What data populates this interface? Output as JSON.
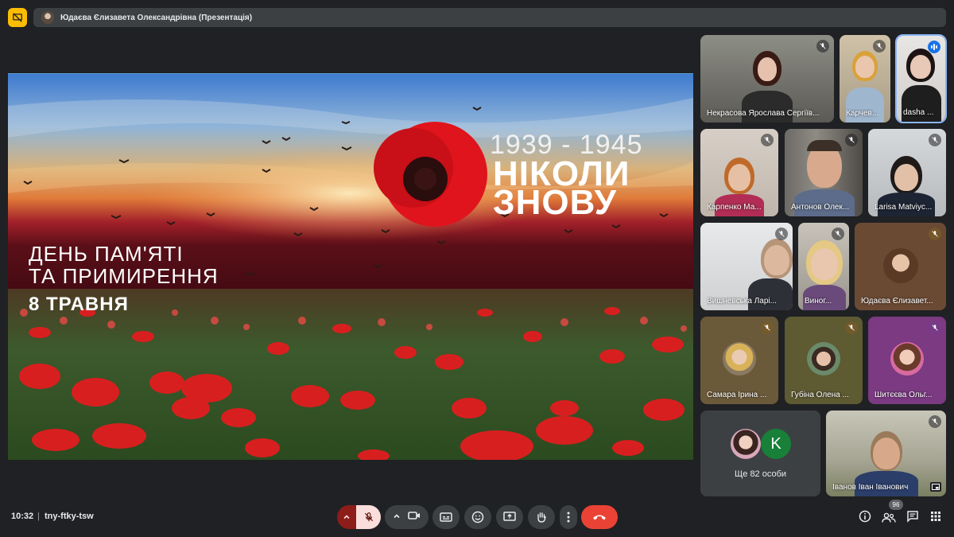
{
  "header": {
    "presenter_label": "Юдаєва Єлизавета Олександрівна (Презентація)"
  },
  "slide": {
    "years": "1939 - 1945",
    "never_line1": "НІКОЛИ",
    "never_line2": "ЗНОВУ",
    "day_line1": "ДЕНЬ ПАМ'ЯТІ",
    "day_line2": "ТА ПРИМИРЕННЯ",
    "date": "8 ТРАВНЯ"
  },
  "participants": [
    {
      "name": "Некрасова Ярослава Сергіїв...",
      "status": "muted"
    },
    {
      "name": "Карчев...",
      "status": "muted"
    },
    {
      "name": "dasha ...",
      "status": "speaking"
    },
    {
      "name": "Карпенко Ма...",
      "status": "muted"
    },
    {
      "name": "Антонов Олек...",
      "status": "muted"
    },
    {
      "name": "Larisa Matviyc...",
      "status": "muted"
    },
    {
      "name": "Вишневська Ларі...",
      "status": "muted"
    },
    {
      "name": "Виног...",
      "status": "muted"
    },
    {
      "name": "Юдаєва Єлизавет...",
      "status": "muted"
    },
    {
      "name": "Самара Ірина ...",
      "status": "muted"
    },
    {
      "name": "Губіна Олена ...",
      "status": "muted"
    },
    {
      "name": "Шитєєва Ольг...",
      "status": "muted"
    },
    {
      "name": "Іванов Іван Іванович",
      "status": "muted"
    }
  ],
  "more_tile": {
    "initial": "K",
    "label": "Ще 82 особи"
  },
  "bottom_bar": {
    "time": "10:32",
    "separator": "|",
    "meeting_code": "tny-ftky-tsw",
    "people_count": "96"
  },
  "icons": {
    "present": "presentation-off-icon",
    "mic": "mic-off-icon",
    "camera": "videocam-icon",
    "captions": "closed-captions-icon",
    "emoji": "emoji-icon",
    "present_screen": "present-screen-icon",
    "hand": "raise-hand-icon",
    "more": "more-vert-icon",
    "end": "call-end-icon",
    "info": "info-icon",
    "people": "people-icon",
    "chat": "chat-icon",
    "activities": "apps-icon"
  },
  "colors": {
    "background": "#202124",
    "accent_blue": "#8ab4f8",
    "end_call_red": "#ea4335",
    "mic_off_bg": "#f9dedc"
  }
}
